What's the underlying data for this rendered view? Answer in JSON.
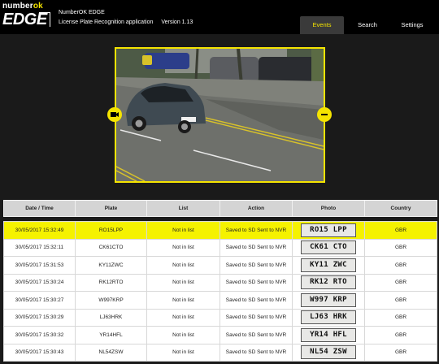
{
  "brand": {
    "top_left": "number",
    "top_right": "ok",
    "bottom": "EDGE"
  },
  "app": {
    "title": "NumberOK EDGE",
    "subtitle": "License Plate Recognition application",
    "version": "Version 1.13"
  },
  "tabs": {
    "events": "Events",
    "search": "Search",
    "settings": "Settings"
  },
  "colors": {
    "accent": "#f5e400",
    "header_bg": "#000000",
    "body_bg": "#1a1a1a"
  },
  "viewer": {
    "prev_icon": "camera-prev-icon",
    "next_icon": "minus-next-icon"
  },
  "table": {
    "headers": [
      "Date / Time",
      "Plate",
      "List",
      "Action",
      "Photo",
      "Country"
    ],
    "rows": [
      {
        "datetime": "30/05/2017 15:32:49",
        "plate": "RO15LPP",
        "list": "Not in list",
        "action": "Saved to SD Sent to NVR",
        "photo": "RO15 LPP",
        "country": "GBR"
      },
      {
        "datetime": "30/05/2017 15:32:11",
        "plate": "CK61CTO",
        "list": "Not in list",
        "action": "Saved to SD Sent to NVR",
        "photo": "CK61 CTO",
        "country": "GBR"
      },
      {
        "datetime": "30/05/2017 15:31:53",
        "plate": "KY11ZWC",
        "list": "Not in list",
        "action": "Saved to SD Sent to NVR",
        "photo": "KY11 ZWC",
        "country": "GBR"
      },
      {
        "datetime": "30/05/2017 15:30:24",
        "plate": "RK12RTO",
        "list": "Not in list",
        "action": "Saved to SD Sent to NVR",
        "photo": "RK12 RTO",
        "country": "GBR"
      },
      {
        "datetime": "30/05/2017 15:30:27",
        "plate": "W997KRP",
        "list": "Not in list",
        "action": "Saved to SD Sent to NVR",
        "photo": "W997 KRP",
        "country": "GBR"
      },
      {
        "datetime": "30/05/2017 15:30:29",
        "plate": "LJ63HRK",
        "list": "Not in list",
        "action": "Saved to SD Sent to NVR",
        "photo": "LJ63 HRK",
        "country": "GBR"
      },
      {
        "datetime": "30/05/2017 15:30:32",
        "plate": "YR14HFL",
        "list": "Not in list",
        "action": "Saved to SD Sent to NVR",
        "photo": "YR14 HFL",
        "country": "GBR"
      },
      {
        "datetime": "30/05/2017 15:30:43",
        "plate": "NL54ZSW",
        "list": "Not in list",
        "action": "Saved to SD Sent to NVR",
        "photo": "NL54 ZSW",
        "country": "GBR"
      }
    ]
  }
}
